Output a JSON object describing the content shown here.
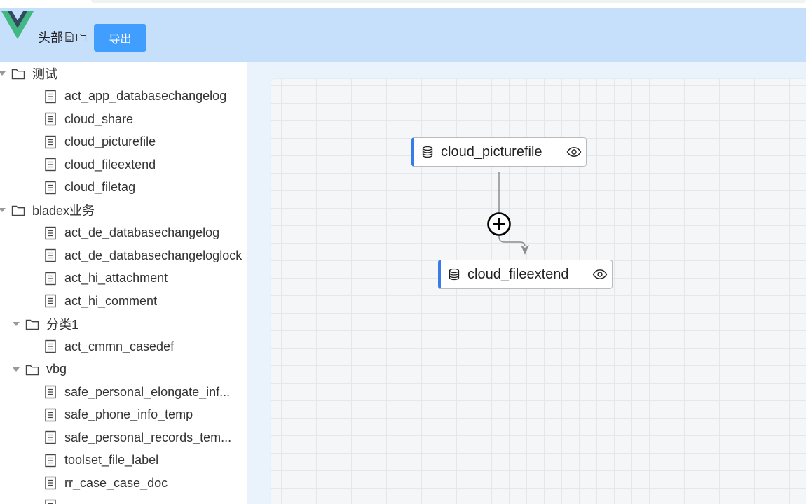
{
  "header": {
    "title": "头部",
    "export_label": "导出"
  },
  "sidebar": {
    "tree": [
      {
        "label": "测试",
        "type": "folder",
        "level": 0,
        "expanded": true
      },
      {
        "label": "act_app_databasechangelog",
        "type": "table",
        "level": 1
      },
      {
        "label": "cloud_share",
        "type": "table",
        "level": 1
      },
      {
        "label": "cloud_picturefile",
        "type": "table",
        "level": 1
      },
      {
        "label": "cloud_fileextend",
        "type": "table",
        "level": 1
      },
      {
        "label": "cloud_filetag",
        "type": "table",
        "level": 1
      },
      {
        "label": "bladex业务",
        "type": "folder",
        "level": 0,
        "expanded": true
      },
      {
        "label": "act_de_databasechangelog",
        "type": "table",
        "level": 1
      },
      {
        "label": "act_de_databasechangeloglock",
        "type": "table",
        "level": 1
      },
      {
        "label": "act_hi_attachment",
        "type": "table",
        "level": 1
      },
      {
        "label": "act_hi_comment",
        "type": "table",
        "level": 1
      },
      {
        "label": "分类1",
        "type": "folder",
        "level": 1,
        "expanded": true
      },
      {
        "label": "act_cmmn_casedef",
        "type": "table",
        "level": 2
      },
      {
        "label": "vbg",
        "type": "folder",
        "level": 1,
        "expanded": true
      },
      {
        "label": "safe_personal_elongate_inf...",
        "type": "table",
        "level": 2
      },
      {
        "label": "safe_phone_info_temp",
        "type": "table",
        "level": 2
      },
      {
        "label": "safe_personal_records_tem...",
        "type": "table",
        "level": 2
      },
      {
        "label": "toolset_file_label",
        "type": "table",
        "level": 2
      },
      {
        "label": "rr_case_case_doc",
        "type": "table",
        "level": 2
      },
      {
        "label": "",
        "type": "table",
        "level": 2
      }
    ]
  },
  "canvas": {
    "nodes": [
      {
        "label": "cloud_picturefile"
      },
      {
        "label": "cloud_fileextend"
      }
    ]
  },
  "colors": {
    "header_bg": "#c6e0fb",
    "button_bg": "#409eff",
    "node_accent": "#3a7bea",
    "canvas_bg": "#f4f6f8"
  }
}
